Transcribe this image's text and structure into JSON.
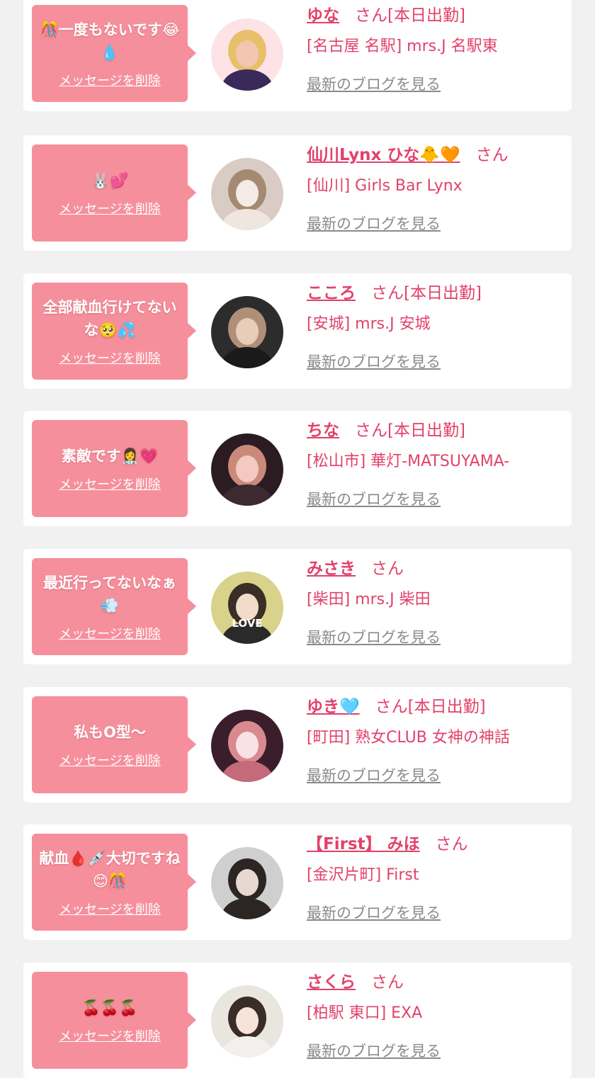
{
  "cards": [
    {
      "message": "🎊一度もないです😂💧",
      "delete_label": "メッセージを削除",
      "name": "ゆな",
      "suffix": "さん[本日出勤]",
      "shop": "[名古屋 名駅] mrs.J 名駅東",
      "blog_label": "最新のブログを見る",
      "avatar": {
        "bg": "#fde3e6",
        "hair": "#e8c06a",
        "cloth": "#3a2a5a",
        "skin": "#f2c6b0"
      }
    },
    {
      "message": "🐰💕",
      "delete_label": "メッセージを削除",
      "name": "仙川Lynx ひな🐥🧡",
      "suffix": "さん",
      "shop": "[仙川] Girls Bar Lynx",
      "blog_label": "最新のブログを見る",
      "avatar": {
        "bg": "#d9ccc4",
        "hair": "#a58a72",
        "cloth": "#efe6df",
        "skin": "#f4ebe6"
      }
    },
    {
      "message": "全部献血行けてないな🥺💦",
      "delete_label": "メッセージを削除",
      "name": "こころ",
      "suffix": "さん[本日出勤]",
      "shop": "[安城] mrs.J 安城",
      "blog_label": "最新のブログを見る",
      "avatar": {
        "bg": "#2c2c2c",
        "hair": "#b08f78",
        "cloth": "#1a1a1a",
        "skin": "#e8cdbb"
      }
    },
    {
      "message": "素敵です👩‍⚕️💗",
      "delete_label": "メッセージを削除",
      "name": "ちな",
      "suffix": "さん[本日出勤]",
      "shop": "[松山市] 華灯-MATSUYAMA-",
      "blog_label": "最新のブログを見る",
      "avatar": {
        "bg": "#2a1c22",
        "hair": "#c98a7a",
        "cloth": "#3d2a30",
        "skin": "#f3c9c0"
      }
    },
    {
      "message": "最近行ってないなぁ💨",
      "delete_label": "メッセージを削除",
      "name": "みさき",
      "suffix": "さん",
      "shop": "[柴田] mrs.J 柴田",
      "blog_label": "最新のブログを見る",
      "avatar": {
        "bg": "#d8d28a",
        "hair": "#3a2e26",
        "cloth": "#2a2a2a",
        "skin": "#f0dcc8",
        "label": "LOVE"
      }
    },
    {
      "message": "私もO型〜",
      "delete_label": "メッセージを削除",
      "name": "ゆき🩵",
      "suffix": "さん[本日出勤]",
      "shop": "[町田] 熟女CLUB 女神の神話",
      "blog_label": "最新のブログを見る",
      "avatar": {
        "bg": "#3b1e2c",
        "hair": "#d98a8f",
        "cloth": "#c46a7a",
        "skin": "#f9e1e6"
      }
    },
    {
      "message": "献血🩸💉大切ですね😊🎊",
      "delete_label": "メッセージを削除",
      "name": "【First】 みほ",
      "suffix": "さん",
      "shop": "[金沢片町] First",
      "blog_label": "最新のブログを見る",
      "avatar": {
        "bg": "#cfcfcf",
        "hair": "#2b2523",
        "cloth": "#2b2523",
        "skin": "#e8d8cf"
      }
    },
    {
      "message": "🍒🍒🍒",
      "delete_label": "メッセージを削除",
      "name": "さくら",
      "suffix": "さん",
      "shop": "[柏駅 東口] EXA",
      "blog_label": "最新のブログを見る",
      "avatar": {
        "bg": "#e9e5df",
        "hair": "#3a2c26",
        "cloth": "#f2f0ec",
        "skin": "#f6e4da"
      }
    }
  ]
}
